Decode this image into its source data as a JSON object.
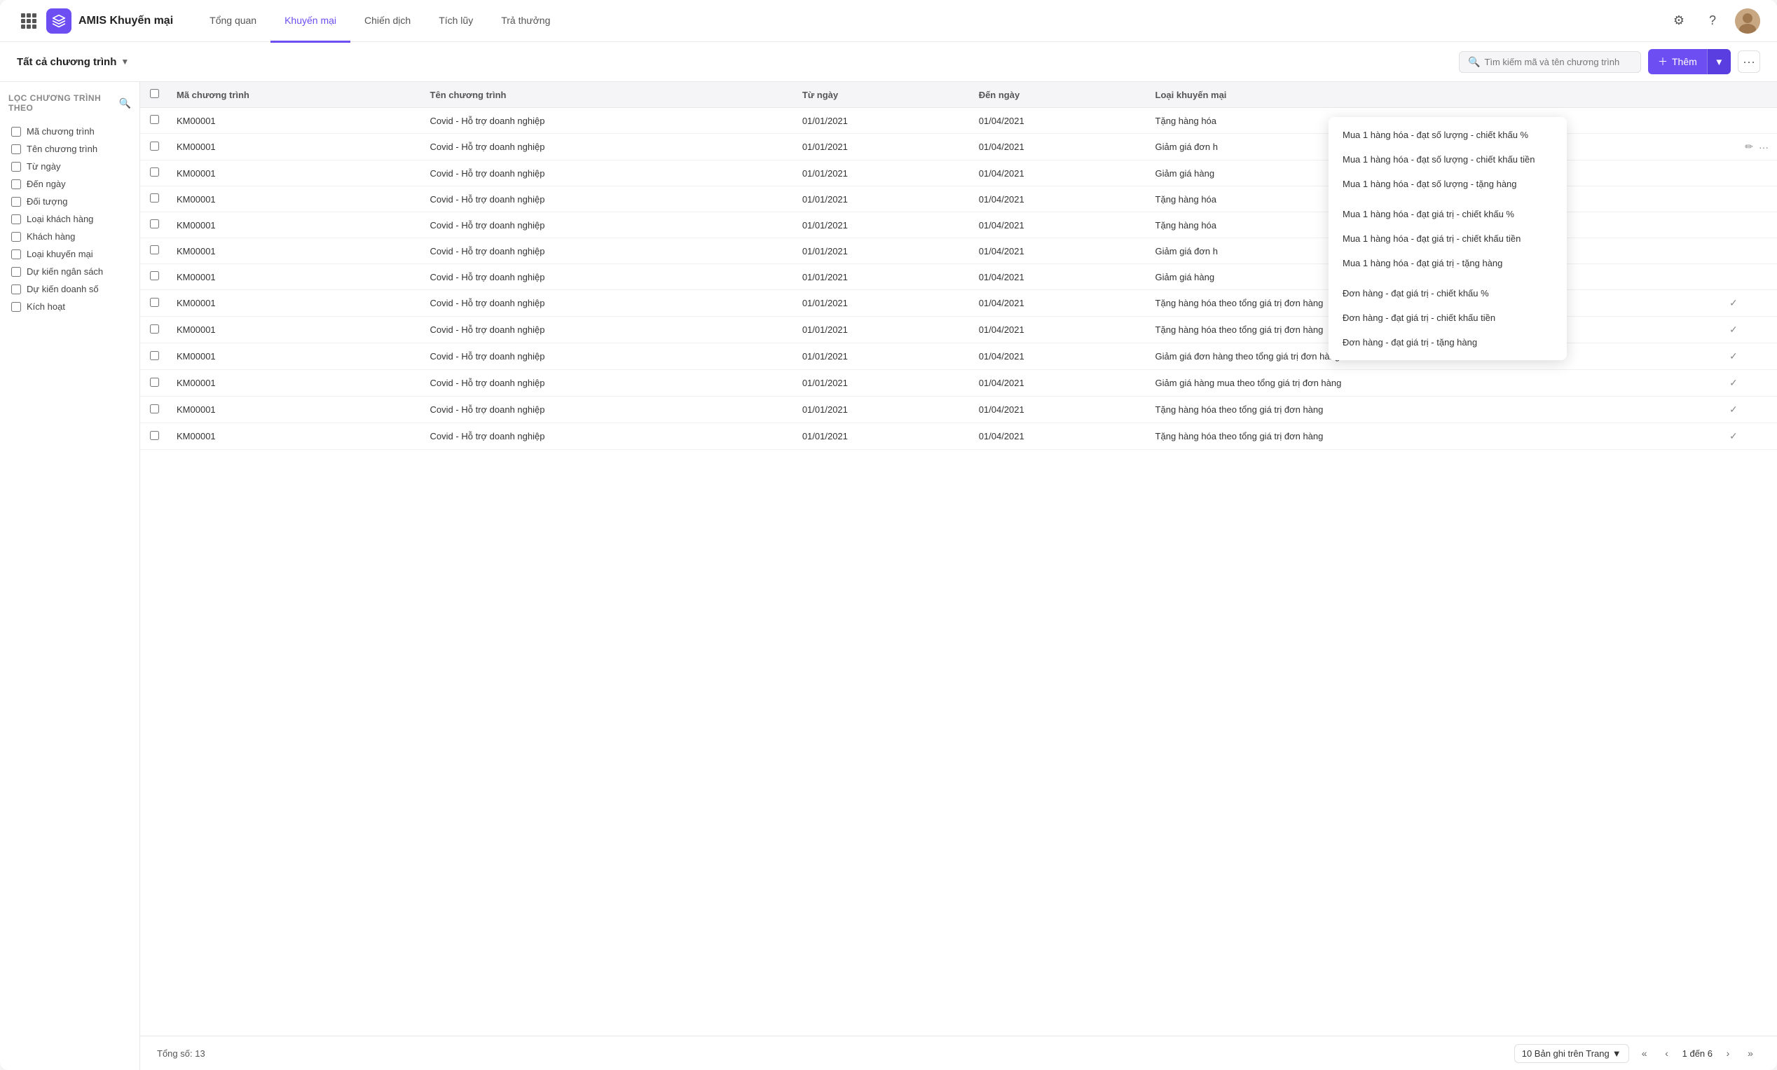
{
  "app": {
    "title": "AMIS Khuyến mại"
  },
  "nav": {
    "tabs": [
      {
        "id": "tong-quan",
        "label": "Tổng quan",
        "active": false
      },
      {
        "id": "khuyen-mai",
        "label": "Khuyến mại",
        "active": true
      },
      {
        "id": "chien-dich",
        "label": "Chiến dịch",
        "active": false
      },
      {
        "id": "tich-luy",
        "label": "Tích lũy",
        "active": false
      },
      {
        "id": "tra-thuong",
        "label": "Trả thưởng",
        "active": false
      }
    ]
  },
  "subHeader": {
    "selector": "Tất cả chương trình",
    "searchPlaceholder": "Tìm kiếm mã và tên chương trình",
    "addButton": "Thêm"
  },
  "filter": {
    "title": "LỌC CHƯƠNG TRÌNH THEO",
    "items": [
      "Mã chương trình",
      "Tên chương trình",
      "Từ ngày",
      "Đến ngày",
      "Đối tượng",
      "Loại khách hàng",
      "Khách hàng",
      "Loại khuyến mại",
      "Dự kiến ngân sách",
      "Dự kiến doanh số",
      "Kích hoạt"
    ]
  },
  "table": {
    "columns": [
      "Mã chương trình",
      "Tên chương trình",
      "Từ ngày",
      "Đến ngày",
      "Loại khuyến mại"
    ],
    "rows": [
      {
        "ma": "KM00001",
        "ten": "Covid - Hỗ trợ doanh nghiệp",
        "tu_ngay": "01/01/2021",
        "den_ngay": "01/04/2021",
        "loai": "Tặng hàng hóa",
        "check": false,
        "action": false
      },
      {
        "ma": "KM00001",
        "ten": "Covid - Hỗ trợ doanh nghiệp",
        "tu_ngay": "01/01/2021",
        "den_ngay": "01/04/2021",
        "loai": "Giảm giá đơn h",
        "check": false,
        "action": true
      },
      {
        "ma": "KM00001",
        "ten": "Covid - Hỗ trợ doanh nghiệp",
        "tu_ngay": "01/01/2021",
        "den_ngay": "01/04/2021",
        "loai": "Giảm giá hàng",
        "check": false,
        "action": false
      },
      {
        "ma": "KM00001",
        "ten": "Covid - Hỗ trợ doanh nghiệp",
        "tu_ngay": "01/01/2021",
        "den_ngay": "01/04/2021",
        "loai": "Tặng hàng hóa",
        "check": false,
        "action": false
      },
      {
        "ma": "KM00001",
        "ten": "Covid - Hỗ trợ doanh nghiệp",
        "tu_ngay": "01/01/2021",
        "den_ngay": "01/04/2021",
        "loai": "Tặng hàng hóa",
        "check": false,
        "action": false
      },
      {
        "ma": "KM00001",
        "ten": "Covid - Hỗ trợ doanh nghiệp",
        "tu_ngay": "01/01/2021",
        "den_ngay": "01/04/2021",
        "loai": "Giảm giá đơn h",
        "check": false,
        "action": false
      },
      {
        "ma": "KM00001",
        "ten": "Covid - Hỗ trợ doanh nghiệp",
        "tu_ngay": "01/01/2021",
        "den_ngay": "01/04/2021",
        "loai": "Giảm giá hàng",
        "check": false,
        "action": false
      },
      {
        "ma": "KM00001",
        "ten": "Covid - Hỗ trợ doanh nghiệp",
        "tu_ngay": "01/01/2021",
        "den_ngay": "01/04/2021",
        "loai": "Tặng hàng hóa theo tổng giá trị đơn hàng",
        "check": true,
        "action": false
      },
      {
        "ma": "KM00001",
        "ten": "Covid - Hỗ trợ doanh nghiệp",
        "tu_ngay": "01/01/2021",
        "den_ngay": "01/04/2021",
        "loai": "Tặng hàng hóa theo tổng giá trị đơn hàng",
        "check": true,
        "action": false
      },
      {
        "ma": "KM00001",
        "ten": "Covid - Hỗ trợ doanh nghiệp",
        "tu_ngay": "01/01/2021",
        "den_ngay": "01/04/2021",
        "loai": "Giảm giá đơn hàng theo tổng giá trị đơn hàng",
        "check": true,
        "action": false
      },
      {
        "ma": "KM00001",
        "ten": "Covid - Hỗ trợ doanh nghiệp",
        "tu_ngay": "01/01/2021",
        "den_ngay": "01/04/2021",
        "loai": "Giảm giá hàng mua theo tổng giá trị đơn hàng",
        "check": true,
        "action": false
      },
      {
        "ma": "KM00001",
        "ten": "Covid - Hỗ trợ doanh nghiệp",
        "tu_ngay": "01/01/2021",
        "den_ngay": "01/04/2021",
        "loai": "Tặng hàng hóa theo tổng giá trị đơn hàng",
        "check": true,
        "action": false
      },
      {
        "ma": "KM00001",
        "ten": "Covid - Hỗ trợ doanh nghiệp",
        "tu_ngay": "01/01/2021",
        "den_ngay": "01/04/2021",
        "loai": "Tặng hàng hóa theo tổng giá trị đơn hàng",
        "check": true,
        "action": false
      }
    ]
  },
  "footer": {
    "totalLabel": "Tổng số:",
    "totalCount": "13",
    "pageSize": "10 Bản ghi trên Trang",
    "pageInfo": "1 đến 6"
  },
  "dropdown": {
    "items": [
      "Mua 1 hàng hóa - đạt số lượng - chiết khấu %",
      "Mua 1 hàng hóa - đạt số lượng - chiết khấu tiền",
      "Mua 1 hàng hóa - đạt số lượng - tặng hàng",
      "Mua 1 hàng hóa - đạt giá trị - chiết khấu %",
      "Mua 1 hàng hóa - đạt giá trị - chiết khấu tiền",
      "Mua 1 hàng hóa - đạt giá trị - tặng hàng",
      "Đơn hàng - đạt giá trị - chiết khấu %",
      "Đơn hàng - đạt giá trị - chiết khấu tiền",
      "Đơn hàng - đạt giá trị - tặng hàng"
    ],
    "groups": [
      0,
      3,
      6
    ]
  }
}
